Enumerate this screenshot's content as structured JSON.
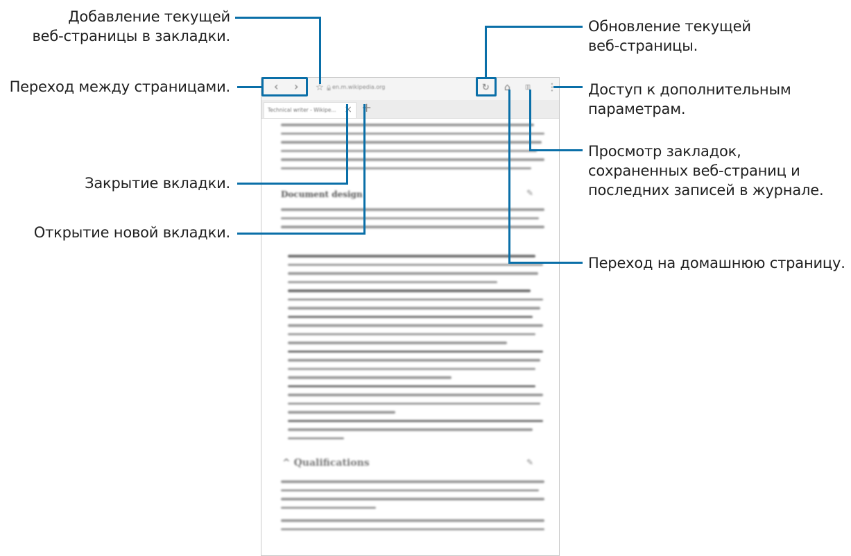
{
  "callouts": {
    "add_bookmark": "Добавление текущей\nвеб-страницы в закладки.",
    "navigate": "Переход между страницами.",
    "close_tab": "Закрытие вкладки.",
    "new_tab": "Открытие новой вкладки.",
    "refresh": "Обновление текущей\nвеб-страницы.",
    "more_options": "Доступ к дополнительным\nпараметрам.",
    "bookmarks_view": "Просмотр закладок,\nсохраненных веб-страниц и\nпоследних записей в журнале.",
    "home": "Переход на домашнюю страницу."
  },
  "browser": {
    "url": "en.m.wikipedia.org",
    "tab_title": "Technical writer - Wikipe...",
    "tab_close": "×",
    "tab_new": "+",
    "back_icon": "‹",
    "forward_icon": "›",
    "star_icon": "☆",
    "lock_icon": "🔒",
    "refresh_icon": "↻",
    "home_icon": "⌂",
    "bookmarks_icon": "▯▯",
    "menu_icon": "⋮"
  },
  "article": {
    "heading_design": "Document design",
    "heading_qualifications": "^ Qualifications"
  },
  "colors": {
    "accent": "#0a6fa8"
  }
}
